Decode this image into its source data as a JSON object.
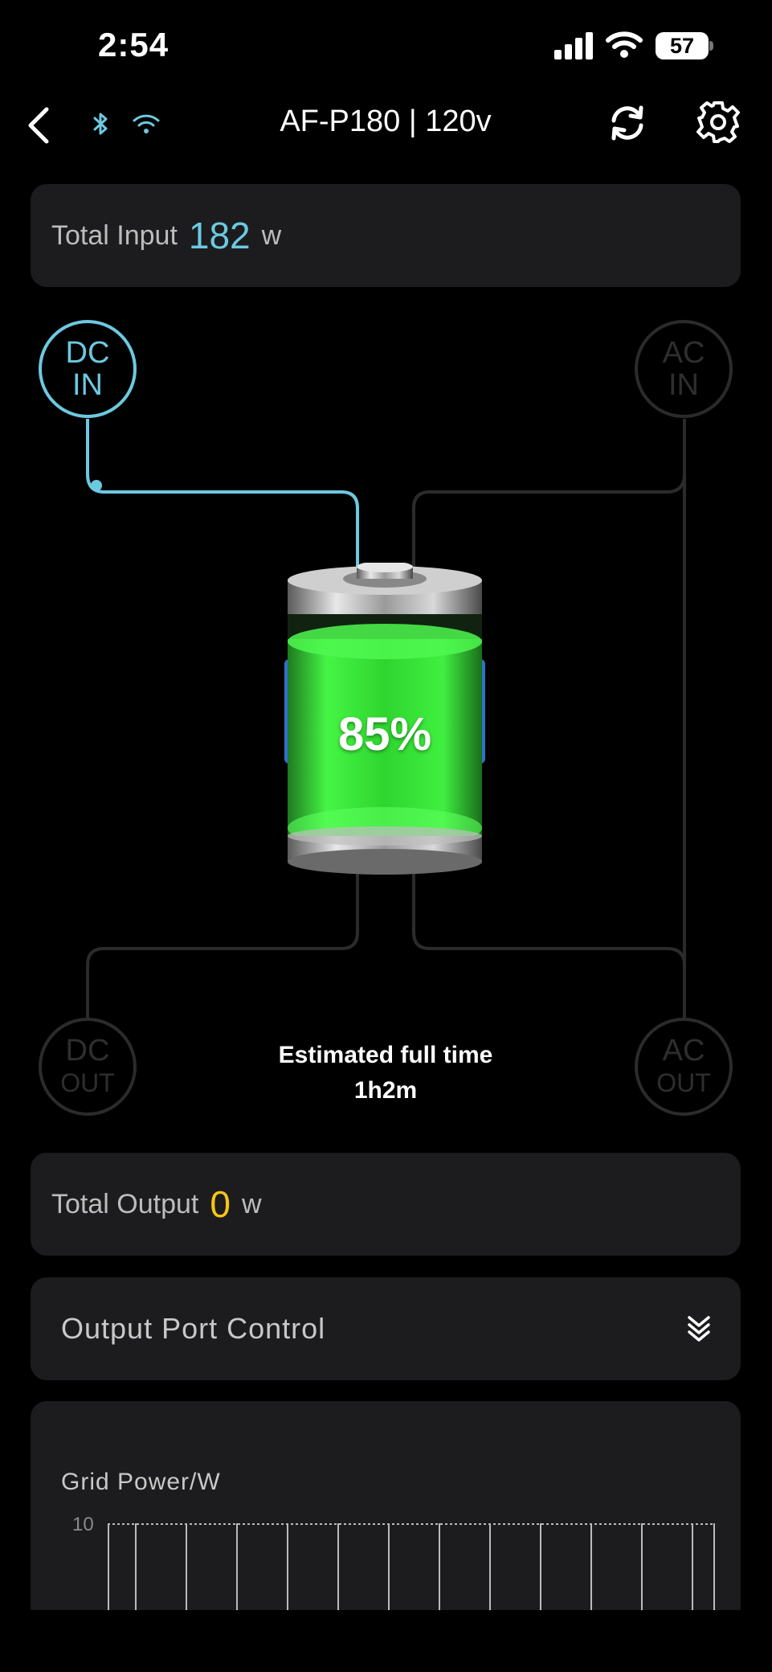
{
  "status_bar": {
    "time": "2:54",
    "battery_level": "57"
  },
  "nav": {
    "title": "AF-P180 | 120v"
  },
  "total_input": {
    "label": "Total Input",
    "value": "182",
    "unit": "w"
  },
  "flow": {
    "dc_in": {
      "line1": "DC",
      "line2": "IN"
    },
    "ac_in": {
      "line1": "AC",
      "line2": "IN"
    },
    "dc_out": {
      "line1": "DC",
      "line2": "OUT"
    },
    "ac_out": {
      "line1": "AC",
      "line2": "OUT"
    },
    "battery_percent": "85%",
    "battery_level_fraction": 0.85,
    "estimate_label": "Estimated full time",
    "estimate_value": "1h2m"
  },
  "total_output": {
    "label": "Total Output",
    "value": "0",
    "unit": "w"
  },
  "port_control": {
    "label": "Output Port Control"
  },
  "chart": {
    "title": "Grid Power/W",
    "y_tick": "10"
  },
  "colors": {
    "accent": "#6cc9e0",
    "output": "#f5c518",
    "card": "#1c1c1e",
    "battery_green": "#39e83a"
  }
}
